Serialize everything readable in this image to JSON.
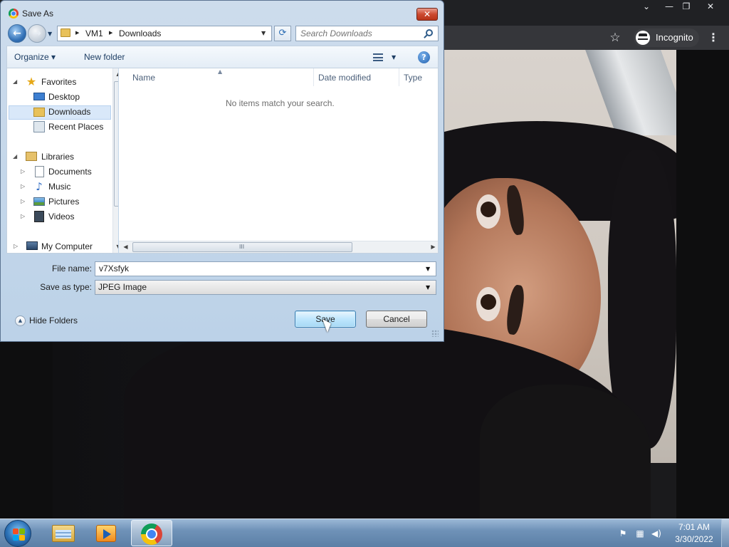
{
  "dialog": {
    "title": "Save As",
    "close_glyph": "✕",
    "app_icon": "chrome-icon"
  },
  "navigation": {
    "back_glyph": "←",
    "forward_glyph": "→",
    "breadcrumbs": [
      "VM1",
      "Downloads"
    ],
    "refresh_glyph": "⟳",
    "search_placeholder": "Search Downloads"
  },
  "commands": {
    "organize": "Organize ▾",
    "new_folder": "New folder",
    "help_glyph": "?"
  },
  "tree": [
    {
      "label": "Favorites",
      "icon": "star-icon"
    },
    {
      "label": "Desktop",
      "icon": "desktop-icon"
    },
    {
      "label": "Downloads",
      "icon": "downloads-folder-icon",
      "selected": true
    },
    {
      "label": "Recent Places",
      "icon": "recent-places-icon"
    },
    {
      "label": "Libraries",
      "icon": "libraries-icon"
    },
    {
      "label": "Documents",
      "icon": "documents-icon"
    },
    {
      "label": "Music",
      "icon": "music-icon"
    },
    {
      "label": "Pictures",
      "icon": "pictures-icon"
    },
    {
      "label": "Videos",
      "icon": "videos-icon"
    },
    {
      "label": "My Computer",
      "icon": "computer-icon"
    }
  ],
  "file_list": {
    "columns": [
      "Name",
      "Date modified",
      "Type"
    ],
    "empty_message": "No items match your search.",
    "scroll_grip": "III"
  },
  "form": {
    "file_name_label": "File name:",
    "file_name_value": "v7Xsfyk",
    "save_type_label": "Save as type:",
    "save_type_value": "JPEG Image"
  },
  "buttons": {
    "hide_folders": "Hide Folders",
    "save": "Save",
    "cancel": "Cancel"
  },
  "chrome": {
    "profile_label": "Incognito",
    "minimize_glyph": "—",
    "restore_glyph": "❐",
    "close_glyph": "✕",
    "tab_dropdown_glyph": "⌄",
    "star_glyph": "☆",
    "menu_glyph": "⋮"
  },
  "taskbar": {
    "time": "7:01 AM",
    "date": "3/30/2022",
    "tray_icons": [
      "action-center-icon",
      "network-icon",
      "volume-icon"
    ]
  }
}
